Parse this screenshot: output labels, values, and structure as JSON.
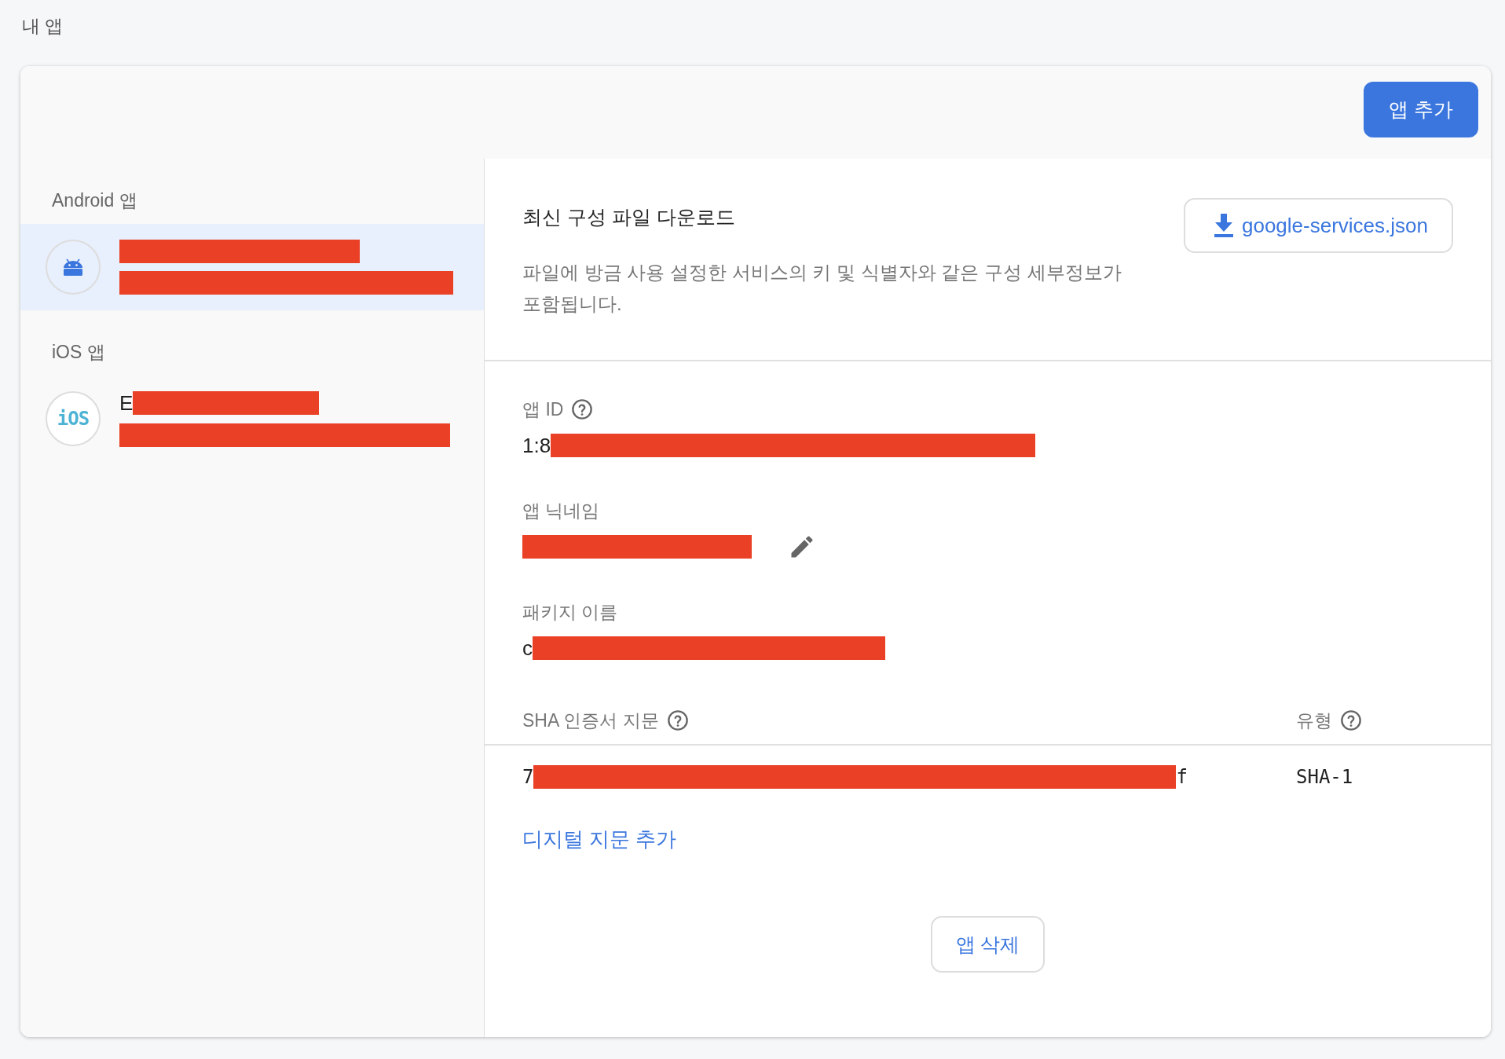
{
  "page_title": "내 앱",
  "add_app_button": "앱 추가",
  "sidebar": {
    "groups": [
      {
        "label": "Android 앱",
        "kind": "android",
        "apps": [
          {
            "selected": true,
            "title": [
              {
                "kind": "redaction"
              }
            ],
            "subtitle": [
              {
                "kind": "redaction"
              }
            ]
          }
        ]
      },
      {
        "label": "iOS 앱",
        "kind": "ios",
        "badge": "iOS",
        "apps": [
          {
            "selected": false,
            "title": [
              {
                "kind": "text",
                "text": "E"
              },
              {
                "kind": "redaction"
              }
            ],
            "subtitle": [
              {
                "kind": "redaction"
              }
            ]
          }
        ]
      }
    ]
  },
  "download": {
    "heading": "최신 구성 파일 다운로드",
    "button": "google-services.json",
    "description": "파일에 방금 사용 설정한 서비스의 키 및 식별자와 같은 구성 세부정보가 포함됩니다."
  },
  "fields": [
    {
      "label": "앱 ID",
      "help": true,
      "editable": false,
      "value": [
        {
          "kind": "text",
          "text": "1:8"
        },
        {
          "kind": "redaction"
        }
      ]
    },
    {
      "label": "앱 닉네임",
      "help": false,
      "editable": true,
      "value": [
        {
          "kind": "redaction"
        }
      ]
    },
    {
      "label": "패키지 이름",
      "help": false,
      "editable": false,
      "value": [
        {
          "kind": "text",
          "text": "c"
        },
        {
          "kind": "redaction"
        }
      ]
    }
  ],
  "sha": {
    "columns": [
      {
        "label": "SHA 인증서 지문",
        "help": true
      },
      {
        "label": "유형",
        "help": true
      }
    ],
    "rows": [
      {
        "fingerprint": [
          {
            "kind": "text",
            "text": "7"
          },
          {
            "kind": "redaction"
          },
          {
            "kind": "text",
            "text": "f"
          }
        ],
        "type": "SHA-1"
      }
    ],
    "add_link": "디지털 지문 추가"
  },
  "delete_button": "앱 삭제"
}
